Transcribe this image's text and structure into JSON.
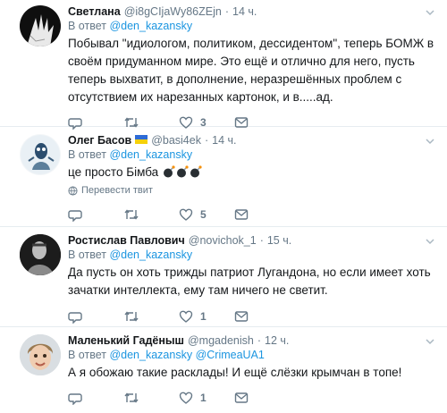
{
  "tweets": [
    {
      "name": "Светлана",
      "handle": "@i8gCIjaWy86ZEjn",
      "sep": "·",
      "time": "14 ч.",
      "reply_prefix": "В ответ",
      "reply_to": "@den_kazansky",
      "text": "Побывал \"идиологом, политиком, дессидентом\", теперь БОМЖ в своём придуманном мире. Это ещё и отлично для него, пусть теперь выхватит, в дополнение, неразрешённых проблем с отсутствием их нарезанных картонок, и в.....ад.",
      "likes": "3"
    },
    {
      "name": "Олег Басов",
      "handle": "@basi4ek",
      "sep": "·",
      "time": "14 ч.",
      "reply_prefix": "В ответ",
      "reply_to": "@den_kazansky",
      "text": "це просто Бімба",
      "translate": "Перевести твит",
      "likes": "5"
    },
    {
      "name": "Ростислав Павлович",
      "handle": "@novichok_1",
      "sep": "·",
      "time": "15 ч.",
      "reply_prefix": "В ответ",
      "reply_to": "@den_kazansky",
      "text": "Да пусть он хоть трижды патриот Лугандона, но если имеет хоть зачатки интеллекта, ему там ничего не светит.",
      "likes": "1"
    },
    {
      "name": "Маленький Гадёныш",
      "handle": "@mgadenish",
      "sep": "·",
      "time": "12 ч.",
      "reply_prefix": "В ответ",
      "reply_to": "@den_kazansky",
      "reply_to_2": "@CrimeaUA1",
      "text": "А я обожаю такие расклады! И ещё слёзки крымчан в топе!",
      "likes": "1"
    }
  ],
  "colors": {
    "link": "#1b95e0",
    "muted": "#657786",
    "text": "#14171a",
    "divider": "#e6ecf0"
  }
}
